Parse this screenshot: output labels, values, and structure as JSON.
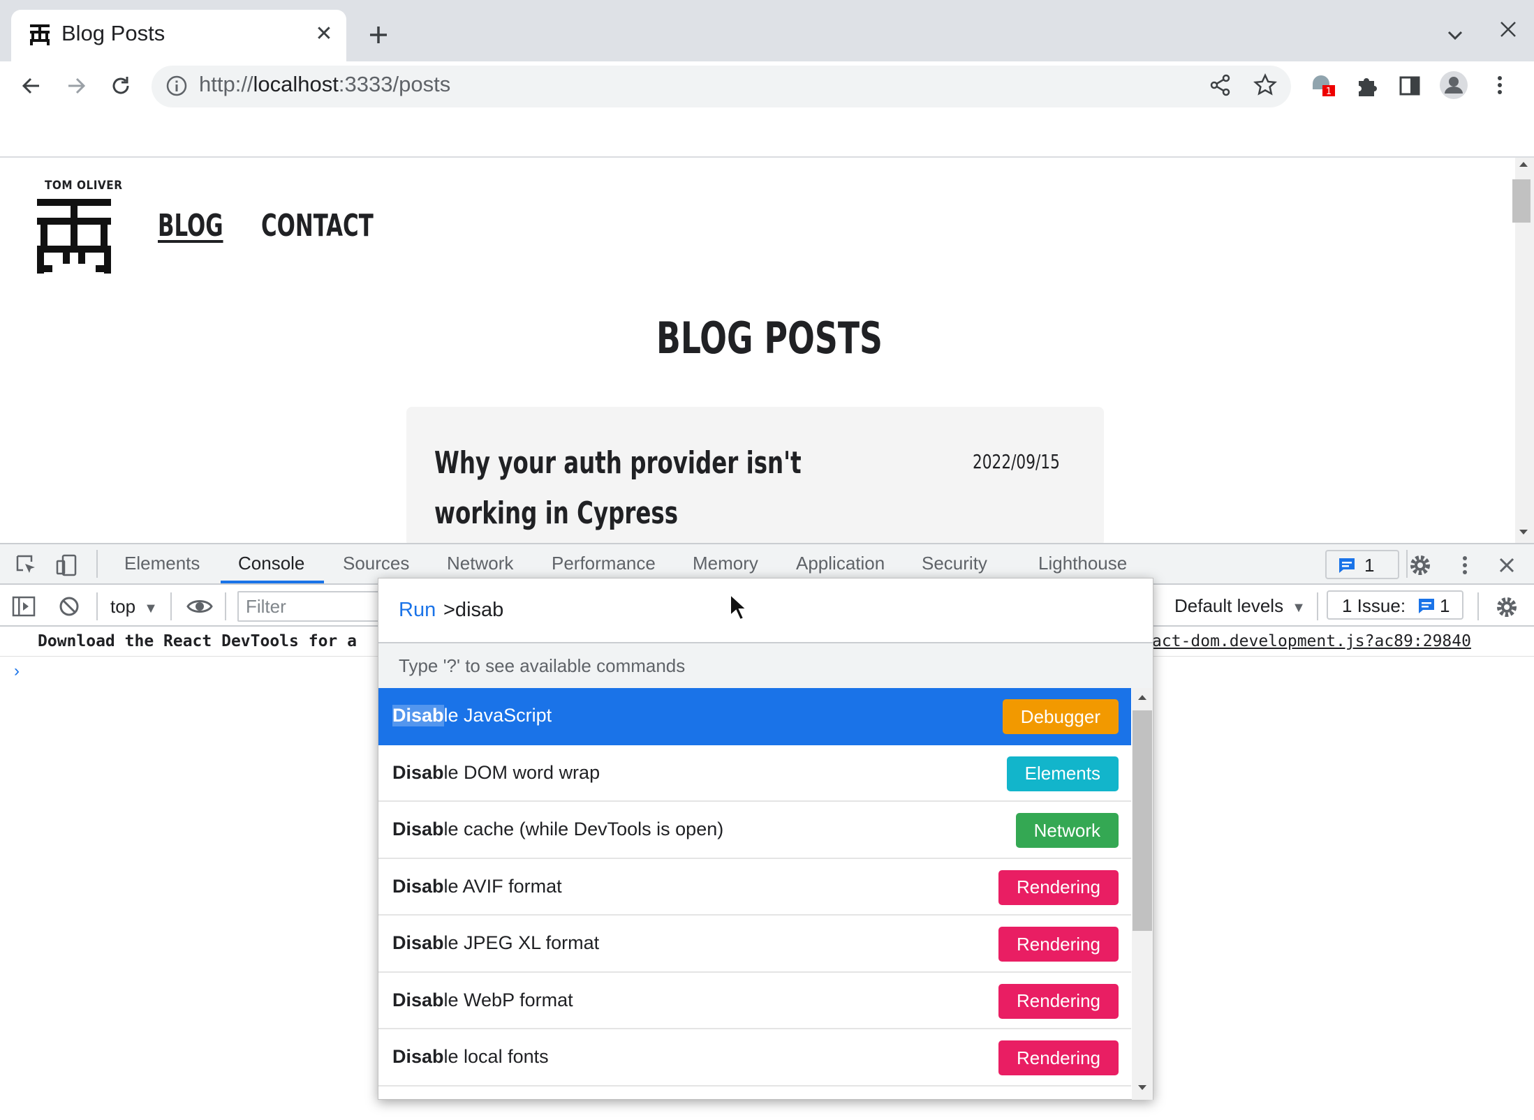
{
  "browser": {
    "tab_title": "Blog Posts",
    "url_prefix": "http://",
    "url_host": "localhost",
    "url_rest": ":3333/posts",
    "extension_badge": "1"
  },
  "site": {
    "brand_name": "TOM OLIVER",
    "nav": {
      "blog": "BLOG",
      "contact": "CONTACT"
    },
    "page_title": "BLOG POSTS",
    "post": {
      "title": "Why your auth provider isn't working in Cypress",
      "date": "2022/09/15"
    }
  },
  "devtools": {
    "tabs": [
      "Elements",
      "Console",
      "Sources",
      "Network",
      "Performance",
      "Memory",
      "Application",
      "Security",
      "Lighthouse"
    ],
    "active_tab": "Console",
    "message_count": "1",
    "context": "top",
    "filter_placeholder": "Filter",
    "levels": "Default levels",
    "issues_label": "1 Issue:",
    "issues_count": "1",
    "console_message": "Download the React DevTools for a",
    "console_source": "act-dom.development.js?ac89:29840",
    "prompt": "›"
  },
  "command_menu": {
    "prefix": "Run",
    "query": ">disab",
    "hint": "Type '?' to see available commands",
    "items": [
      {
        "match": "Disab",
        "rest": "le JavaScript",
        "badge": "Debugger",
        "badge_color": "#f29900",
        "selected": true
      },
      {
        "match": "Disab",
        "rest": "le DOM word wrap",
        "badge": "Elements",
        "badge_color": "#12b5cb"
      },
      {
        "match": "Disab",
        "rest": "le cache (while DevTools is open)",
        "badge": "Network",
        "badge_color": "#34a853"
      },
      {
        "match": "Disab",
        "rest": "le AVIF format",
        "badge": "Rendering",
        "badge_color": "#e91e63"
      },
      {
        "match": "Disab",
        "rest": "le JPEG XL format",
        "badge": "Rendering",
        "badge_color": "#e91e63"
      },
      {
        "match": "Disab",
        "rest": "le WebP format",
        "badge": "Rendering",
        "badge_color": "#e91e63"
      },
      {
        "match": "Disab",
        "rest": "le local fonts",
        "badge": "Rendering",
        "badge_color": "#e91e63"
      }
    ]
  },
  "colors": {
    "accent": "#1a73e8",
    "tab_strip": "#dee1e6"
  }
}
